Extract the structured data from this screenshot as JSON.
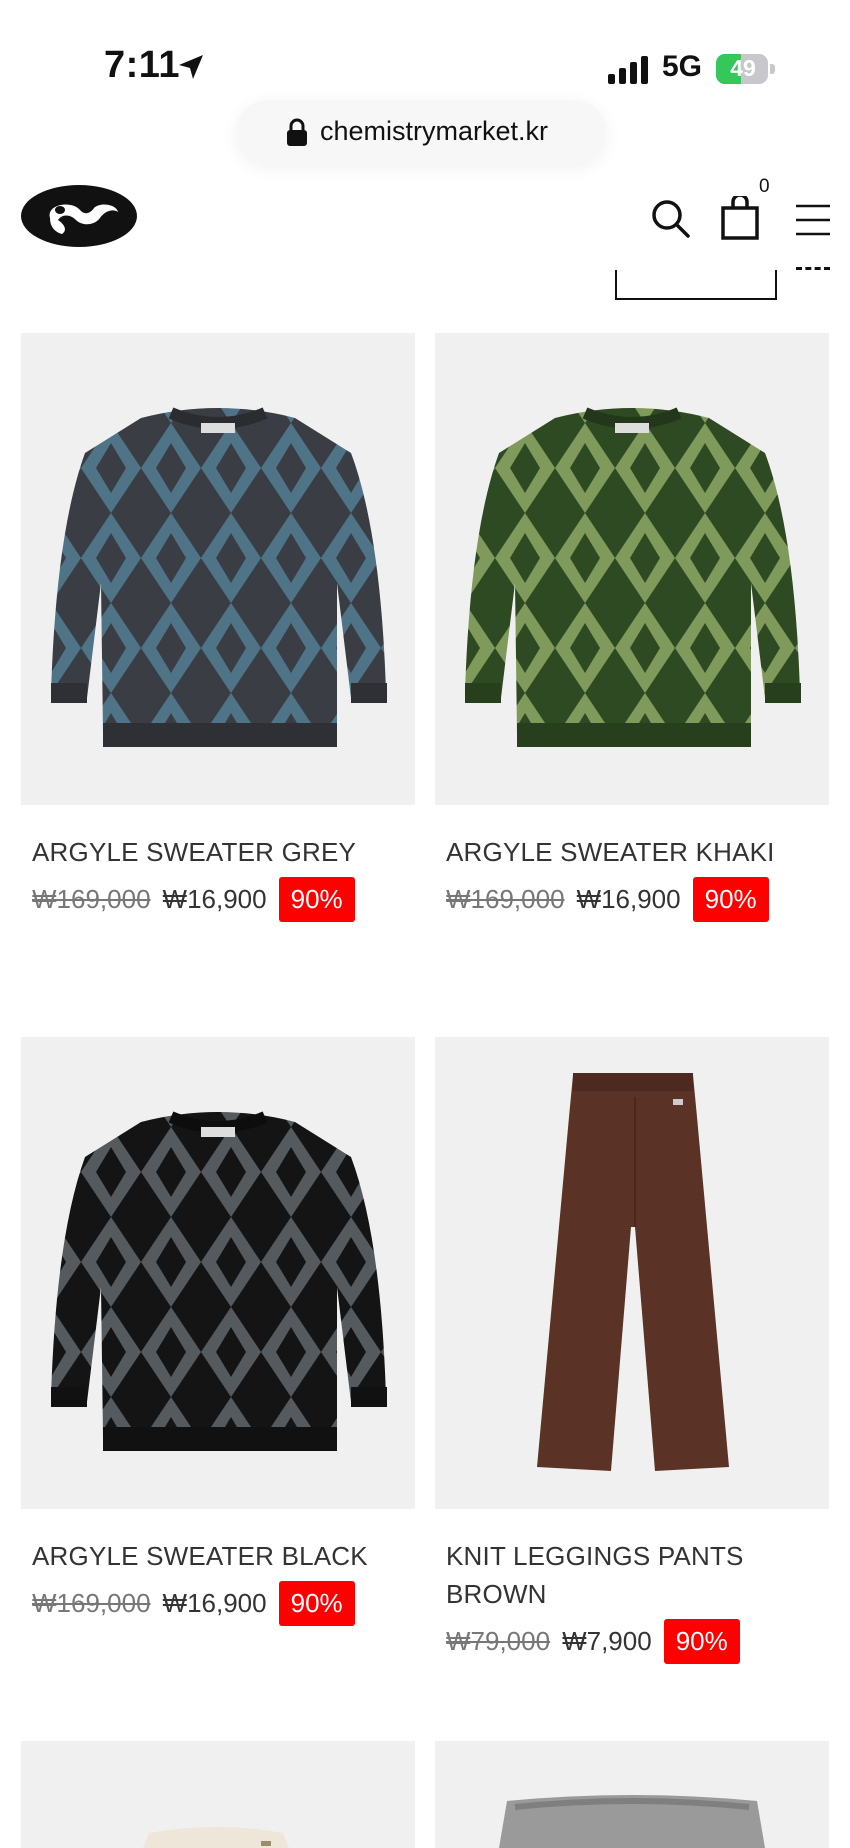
{
  "status_bar": {
    "time": "7:11",
    "network": "5G",
    "battery": "49",
    "battery_level": 0.49
  },
  "browser": {
    "url": "chemistrymarket.kr"
  },
  "header": {
    "cart_count": "0"
  },
  "colors": {
    "sale_badge": "#ff0000",
    "image_bg": "#f0f0f0",
    "battery_green": "#34c759"
  },
  "products": [
    {
      "name": "ARGYLE SWEATER GREY",
      "original_price": "₩169,000",
      "sale_price": "₩16,900",
      "discount": "90%"
    },
    {
      "name": "ARGYLE SWEATER KHAKI",
      "original_price": "₩169,000",
      "sale_price": "₩16,900",
      "discount": "90%"
    },
    {
      "name": "ARGYLE SWEATER BLACK",
      "original_price": "₩169,000",
      "sale_price": "₩16,900",
      "discount": "90%"
    },
    {
      "name": "KNIT LEGGINGS PANTS BROWN",
      "original_price": "₩79,000",
      "sale_price": "₩7,900",
      "discount": "90%"
    }
  ]
}
